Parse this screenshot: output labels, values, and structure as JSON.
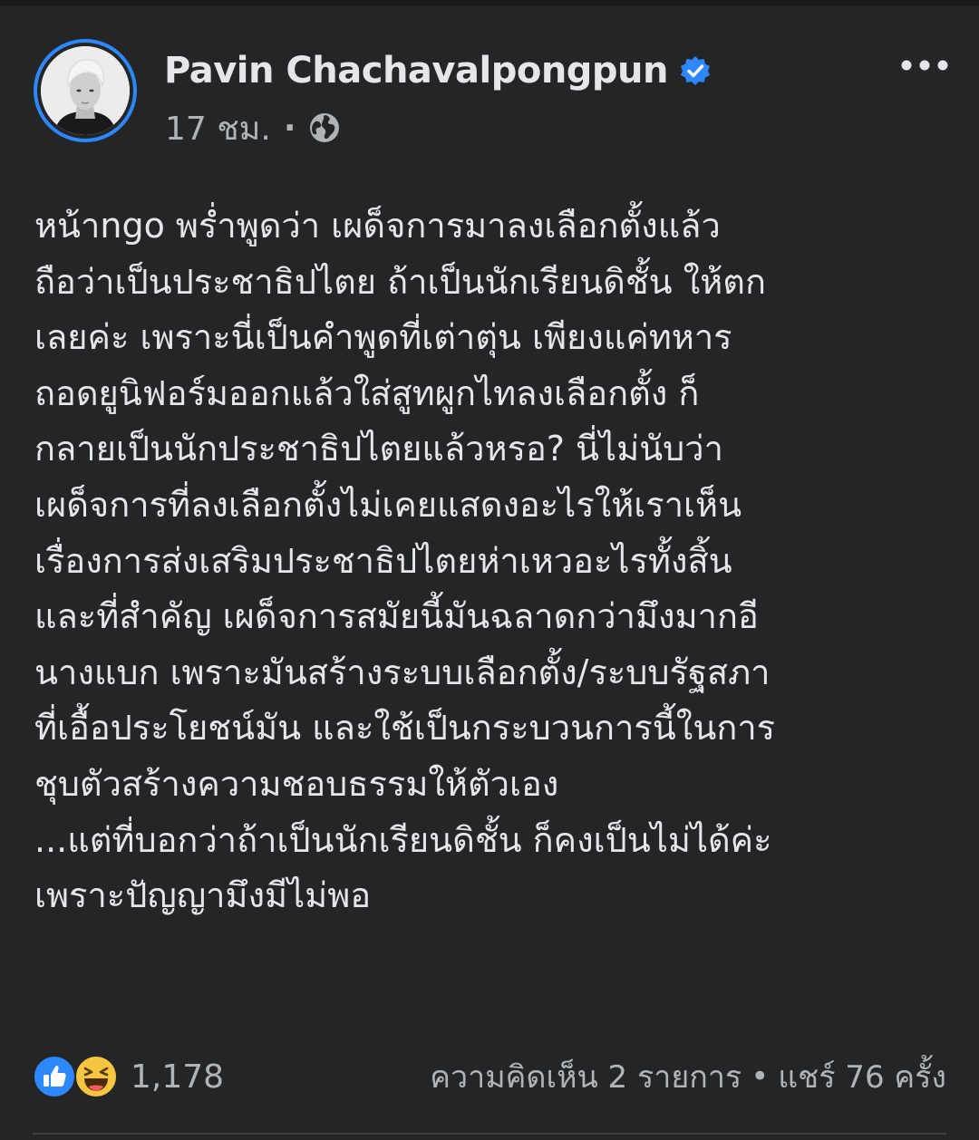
{
  "post": {
    "author": {
      "name": "Pavin Chachavalpongpun",
      "verified": true
    },
    "meta": {
      "time": "17 ชม.",
      "separator": "·",
      "audience_icon": "globe-icon"
    },
    "more_icon": "more-horizontal-icon",
    "body_lines": [
      "หน้าngo พร่ำพูดว่า เผด็จการมาลงเลือกตั้งแล้ว",
      "ถือว่าเป็นประชาธิปไตย ถ้าเป็นนักเรียนดิชั้น ให้ตก",
      "เลยค่ะ เพราะนี่เป็นคำพูดที่เต่าตุ่น เพียงแค่ทหาร",
      "ถอดยูนิฟอร์มออกแล้วใส่สูทผูกไทลงเลือกตั้ง ก็",
      "กลายเป็นนักประชาธิปไตยแล้วหรอ? นี่ไม่นับว่า",
      "เผด็จการที่ลงเลือกตั้งไม่เคยแสดงอะไรให้เราเห็น",
      "เรื่องการส่งเสริมประชาธิปไตยห่าเหวอะไรทั้งสิ้น",
      "และที่สำคัญ เผด็จการสมัยนี้มันฉลาดกว่ามึงมากอี",
      "นางแบก เพราะมันสร้างระบบเลือกตั้ง/ระบบรัฐสภา",
      "ที่เอื้อประโยชน์มัน และใช้เป็นกระบวนการนี้ในการ",
      "ชุบตัวสร้างความชอบธรรมให้ตัวเอง",
      "...แต่ที่บอกว่าถ้าเป็นนักเรียนดิชั้น ก็คงเป็นไม่ได้ค่ะ",
      "เพราะปัญญามึงมีไม่พอ"
    ],
    "reactions": {
      "icons": [
        "like-icon",
        "haha-icon"
      ],
      "count": "1,178"
    },
    "stats": {
      "comments": "ความคิดเห็น 2 รายการ",
      "separator": "•",
      "shares": "แชร์ 76 ครั้ง"
    }
  },
  "colors": {
    "background": "#242526",
    "text_primary": "#e4e6eb",
    "text_secondary": "#b0b3b8",
    "accent_blue": "#2d88ff"
  }
}
